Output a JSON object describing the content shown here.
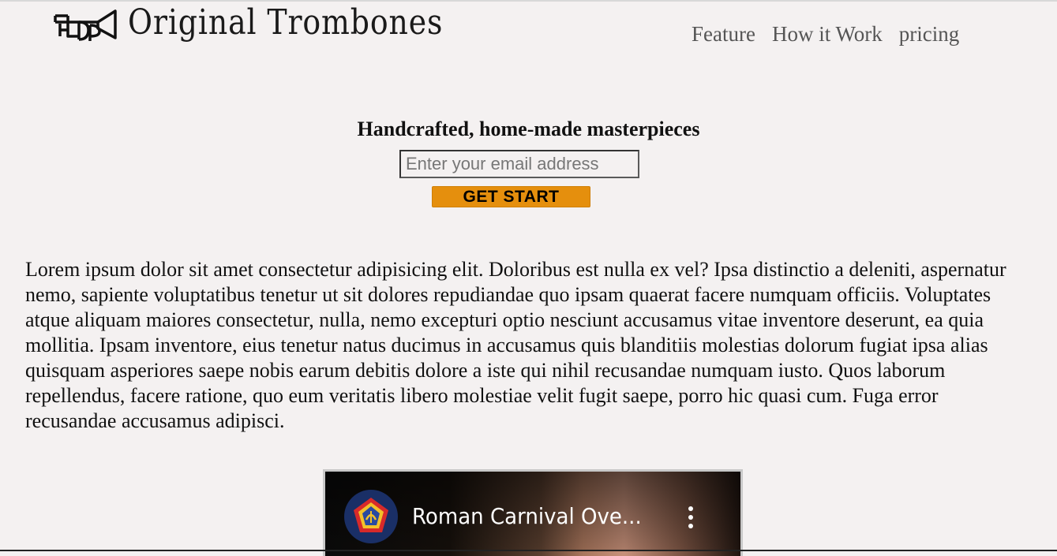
{
  "header": {
    "brand": "Original Trombones",
    "logo_icon": "trombone-icon",
    "nav": [
      {
        "label": "Feature"
      },
      {
        "label": "How it Work"
      },
      {
        "label": "pricing"
      }
    ]
  },
  "hero": {
    "headline": "Handcrafted, home-made masterpieces",
    "email_placeholder": "Enter your email address",
    "email_value": "",
    "cta_label": "GET START",
    "cta_color": "#e58f0d"
  },
  "about": {
    "text": "Lorem ipsum dolor sit amet consectetur adipisicing elit. Doloribus est nulla ex vel? Ipsa distinctio a deleniti, aspernatur nemo, sapiente voluptatibus tenetur ut sit dolores repudiandae quo ipsam quaerat facere numquam officiis. Voluptates atque aliquam maiores consectetur, nulla, nemo excepturi optio nesciunt accusamus vitae inventore deserunt, ea quia mollitia. Ipsam inventore, eius tenetur natus ducimus in accusamus quis blanditiis molestias dolorum fugiat ipsa alias quisquam asperiores saepe nobis earum debitis dolore a iste qui nihil recusandae numquam iusto. Quos laborum repellendus, facere ratione, quo eum veritatis libero molestiae velit fugit saepe, porro hic quasi cum. Fuga error recusandae accusamus adipisci."
  },
  "video": {
    "title": "Roman Carnival Ove...",
    "channel_icon": "channel-emblem-icon",
    "menu_icon": "more-vertical-icon"
  }
}
